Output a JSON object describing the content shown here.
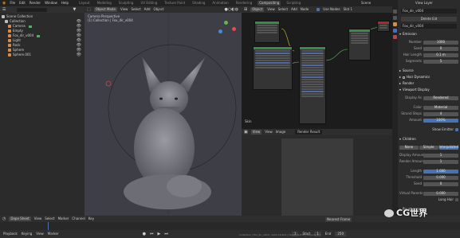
{
  "topbar": {
    "menus": [
      "File",
      "Edit",
      "Render",
      "Window",
      "Help"
    ],
    "workspaces": [
      "Layout",
      "Modeling",
      "Sculpting",
      "UV Editing",
      "Texture Paint",
      "Shading",
      "Animation",
      "Rendering",
      "Compositing",
      "Scripting"
    ],
    "active_workspace": "Compositing",
    "scene": "Scene",
    "view_layer": "View Layer"
  },
  "outliner": {
    "items": [
      {
        "label": "Scene Collection",
        "indent": 0,
        "color": "#bdbdbd"
      },
      {
        "label": "Collection",
        "indent": 1,
        "color": "#bdbdbd"
      },
      {
        "label": "Camera",
        "indent": 2,
        "color": "#d98c4a"
      },
      {
        "label": "Empty",
        "indent": 2,
        "color": "#d98c4a"
      },
      {
        "label": "Fox_dir_v004",
        "indent": 2,
        "color": "#d98c4a"
      },
      {
        "label": "Light",
        "indent": 2,
        "color": "#d98c4a"
      },
      {
        "label": "Rock",
        "indent": 2,
        "color": "#d98c4a"
      },
      {
        "label": "Sphere",
        "indent": 2,
        "color": "#d98c4a"
      },
      {
        "label": "Sphere.001",
        "indent": 2,
        "color": "#d98c4a"
      }
    ]
  },
  "viewport": {
    "header_items": [
      "Object Mode",
      "View",
      "Select",
      "Add",
      "Object"
    ],
    "overlay_line1": "Camera Perspective",
    "overlay_line2": "(1) Collection | Fox_dir_v004"
  },
  "nodes": {
    "header_items": [
      "Object",
      "View",
      "Select",
      "Add",
      "Node",
      "Use Nodes",
      "Slot 1"
    ],
    "label": "Skin"
  },
  "image_editor": {
    "header_items": [
      "View",
      "View",
      "Image",
      "Render Result"
    ]
  },
  "properties": {
    "object_name": "Fox_dir_v004",
    "material": "Delete Eid",
    "sections": [
      {
        "label": "Emission",
        "expanded": true
      },
      {
        "label": "Source",
        "expanded": false
      },
      {
        "label": "Hair Dynamics",
        "expanded": false
      },
      {
        "label": "Render",
        "expanded": false
      },
      {
        "label": "Viewport Display",
        "expanded": true
      },
      {
        "label": "Children",
        "expanded": true
      },
      {
        "label": "Roughness",
        "expanded": false
      }
    ],
    "emission_rows": [
      {
        "label": "Number",
        "value": "1000"
      },
      {
        "label": "Seed",
        "value": "0"
      },
      {
        "label": "Hair Length",
        "value": "0.1 m"
      },
      {
        "label": "Segments",
        "value": "5"
      }
    ],
    "viewport_rows": [
      {
        "label": "Display As",
        "value": "Rendered"
      },
      {
        "label": "Color",
        "value": "Material"
      },
      {
        "label": "Strand Steps",
        "value": "4"
      },
      {
        "label": "Amount",
        "value": "100%"
      }
    ],
    "show_emitter_label": "Show Emitter",
    "children_tabs": [
      "None",
      "Simple",
      "Interpolated"
    ],
    "children_active": "Interpolated",
    "children_rows": [
      {
        "label": "Display Amount",
        "value": "1"
      },
      {
        "label": "Render Amount",
        "value": "1"
      },
      {
        "label": "Length",
        "value": "1.000"
      },
      {
        "label": "Threshold",
        "value": "0.000"
      },
      {
        "label": "Seed",
        "value": "0"
      },
      {
        "label": "Virtual Parents",
        "value": "0.000"
      },
      {
        "label": "Long Hair",
        "value": ""
      }
    ]
  },
  "timeline": {
    "header_items": [
      "Dope Sheet",
      "View",
      "Select",
      "Marker",
      "Channel",
      "Key"
    ],
    "nearest_frame": "Nearest Frame",
    "footer_items": [
      "Playback",
      "Keying",
      "View",
      "Marker"
    ],
    "start_label": "Start",
    "start_value": "1",
    "end_label": "End",
    "end_value": "250",
    "current_frame": "1",
    "status": "Collection | Fox_dir_v004 | Verts 18,402 | Faces 16,838 | Objects 1/7",
    "watermark": "CG世界"
  }
}
